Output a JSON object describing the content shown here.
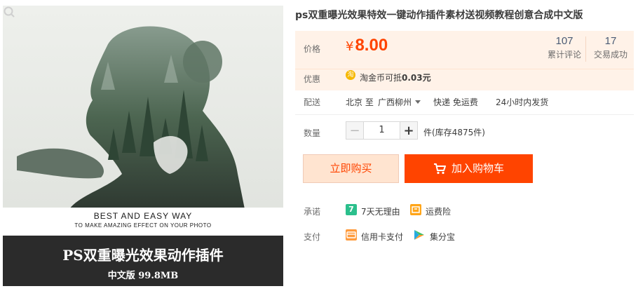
{
  "product": {
    "title": "ps双重曝光效果特效一键动作插件素材送视频教程创意合成中文版",
    "image": {
      "caption_line1": "BEST AND EASY WAY",
      "caption_line2": "TO MAKE AMAZING  EFFECT ON YOUR PHOTO",
      "band_title": "PS双重曝光效果动作插件",
      "band_subtitle": "中文版  99.8MB"
    }
  },
  "price": {
    "label": "价格",
    "currency": "¥",
    "value": "8.00",
    "reviews_count": "107",
    "reviews_label": "累计评论",
    "trades_count": "17",
    "trades_label": "交易成功"
  },
  "promo": {
    "label": "优惠",
    "icon_glyph": "淘",
    "text_prefix": "淘金币可抵",
    "text_amount": "0.03元"
  },
  "delivery": {
    "label": "配送",
    "from": "北京 至",
    "to": "广西柳州",
    "method": "快递 免运费",
    "ship_time": "24小时内发货"
  },
  "quantity": {
    "label": "数量",
    "minus": "−",
    "value": "1",
    "plus": "+",
    "stock": "件(库存4875件)"
  },
  "actions": {
    "buy_now": "立即购买",
    "add_to_cart": "加入购物车"
  },
  "promise": {
    "label": "承诺",
    "item1_icon": "7",
    "item1": "7天无理由",
    "item2": "运费险"
  },
  "payment": {
    "label": "支付",
    "item1": "信用卡支付",
    "item2": "集分宝"
  },
  "colors": {
    "accent": "#ff4400",
    "price_bg": "#fff2e8",
    "buy_bg": "#ffe4d0",
    "promise_green": "#2bbf8c",
    "promise_orange": "#ffa519"
  }
}
